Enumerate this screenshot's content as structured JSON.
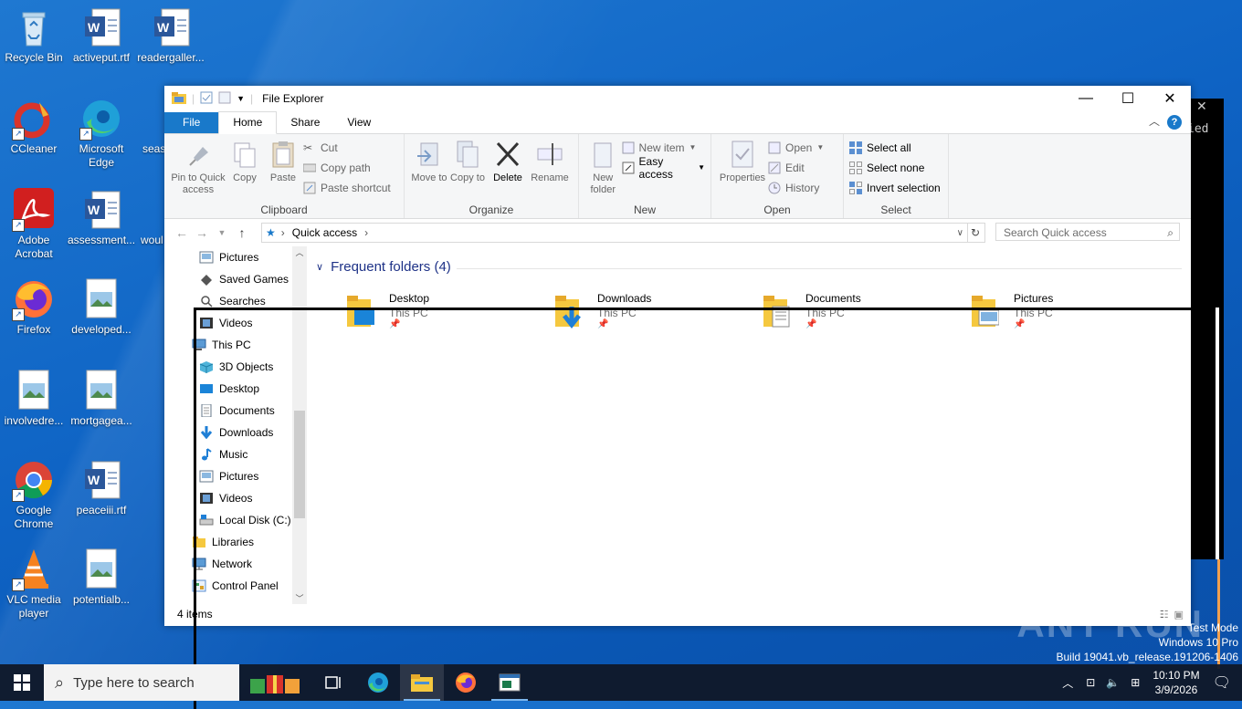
{
  "desktop": {
    "icons": [
      {
        "label": "Recycle Bin",
        "icon": "recycle-bin-icon"
      },
      {
        "label": "activeput.rtf",
        "icon": "word-doc-icon"
      },
      {
        "label": "readergaller...",
        "icon": "word-doc-icon"
      },
      {
        "label": "CCleaner",
        "icon": "ccleaner-icon"
      },
      {
        "label": "Microsoft Edge",
        "icon": "edge-icon"
      },
      {
        "label": "seas",
        "icon": "word-doc-icon"
      },
      {
        "label": "Adobe Acrobat",
        "icon": "acrobat-icon"
      },
      {
        "label": "assessment...",
        "icon": "word-doc-icon"
      },
      {
        "label": "woul",
        "icon": "word-doc-icon"
      },
      {
        "label": "Firefox",
        "icon": "firefox-icon"
      },
      {
        "label": "developed...",
        "icon": "image-file-icon"
      },
      {
        "label": "involvedre...",
        "icon": "image-file-icon"
      },
      {
        "label": "mortgagea...",
        "icon": "image-file-icon"
      },
      {
        "label": "Google Chrome",
        "icon": "chrome-icon"
      },
      {
        "label": "peaceiii.rtf",
        "icon": "word-doc-icon"
      },
      {
        "label": "VLC media player",
        "icon": "vlc-icon"
      },
      {
        "label": "potentialb...",
        "icon": "image-file-icon"
      }
    ]
  },
  "console": {
    "text": "ied",
    "close": "✕"
  },
  "explorer": {
    "title": "File Explorer",
    "tabs": {
      "file": "File",
      "home": "Home",
      "share": "Share",
      "view": "View"
    },
    "help": "?",
    "ribbon": {
      "clipboard": {
        "name": "Clipboard",
        "pin": "Pin to Quick access",
        "copy": "Copy",
        "paste": "Paste",
        "cut": "Cut",
        "copy_path": "Copy path",
        "paste_shortcut": "Paste shortcut"
      },
      "organize": {
        "name": "Organize",
        "move_to": "Move to",
        "copy_to": "Copy to",
        "delete": "Delete",
        "rename": "Rename"
      },
      "new": {
        "name": "New",
        "new_folder": "New folder",
        "new_item": "New item",
        "easy_access": "Easy access"
      },
      "open": {
        "name": "Open",
        "properties": "Properties",
        "open": "Open",
        "edit": "Edit",
        "history": "History"
      },
      "select": {
        "name": "Select",
        "select_all": "Select all",
        "select_none": "Select none",
        "invert": "Invert selection"
      }
    },
    "address": {
      "location": "Quick access",
      "search_placeholder": "Search Quick access"
    },
    "nav_items": [
      {
        "label": "Pictures",
        "icon": "pictures-icon"
      },
      {
        "label": "Saved Games",
        "icon": "saved-games-icon"
      },
      {
        "label": "Searches",
        "icon": "searches-icon"
      },
      {
        "label": "Videos",
        "icon": "videos-icon"
      },
      {
        "label": "This PC",
        "icon": "this-pc-icon"
      },
      {
        "label": "3D Objects",
        "icon": "3d-objects-icon"
      },
      {
        "label": "Desktop",
        "icon": "desktop-folder-icon"
      },
      {
        "label": "Documents",
        "icon": "documents-icon"
      },
      {
        "label": "Downloads",
        "icon": "downloads-icon"
      },
      {
        "label": "Music",
        "icon": "music-icon"
      },
      {
        "label": "Pictures",
        "icon": "pictures-icon"
      },
      {
        "label": "Videos",
        "icon": "videos-icon"
      },
      {
        "label": "Local Disk (C:)",
        "icon": "local-disk-icon"
      },
      {
        "label": "Libraries",
        "icon": "libraries-icon"
      },
      {
        "label": "Network",
        "icon": "network-icon"
      },
      {
        "label": "Control Panel",
        "icon": "control-panel-icon"
      }
    ],
    "frequent_header": "Frequent folders (4)",
    "folders": [
      {
        "name": "Desktop",
        "location": "This PC"
      },
      {
        "name": "Downloads",
        "location": "This PC"
      },
      {
        "name": "Documents",
        "location": "This PC"
      },
      {
        "name": "Pictures",
        "location": "This PC"
      }
    ],
    "status": "4 items"
  },
  "watermark": "ANY RUN",
  "system": {
    "test_mode": "Test Mode",
    "edition": "Windows 10 Pro",
    "build": "Build 19041.vb_release.191206-1406"
  },
  "taskbar": {
    "search_placeholder": "Type here to search",
    "time": "10:10 PM",
    "date": "3/9/2026"
  },
  "colors": {
    "accent": "#1979ca",
    "desktop": "#0e63c4",
    "taskbar": "#101828"
  }
}
